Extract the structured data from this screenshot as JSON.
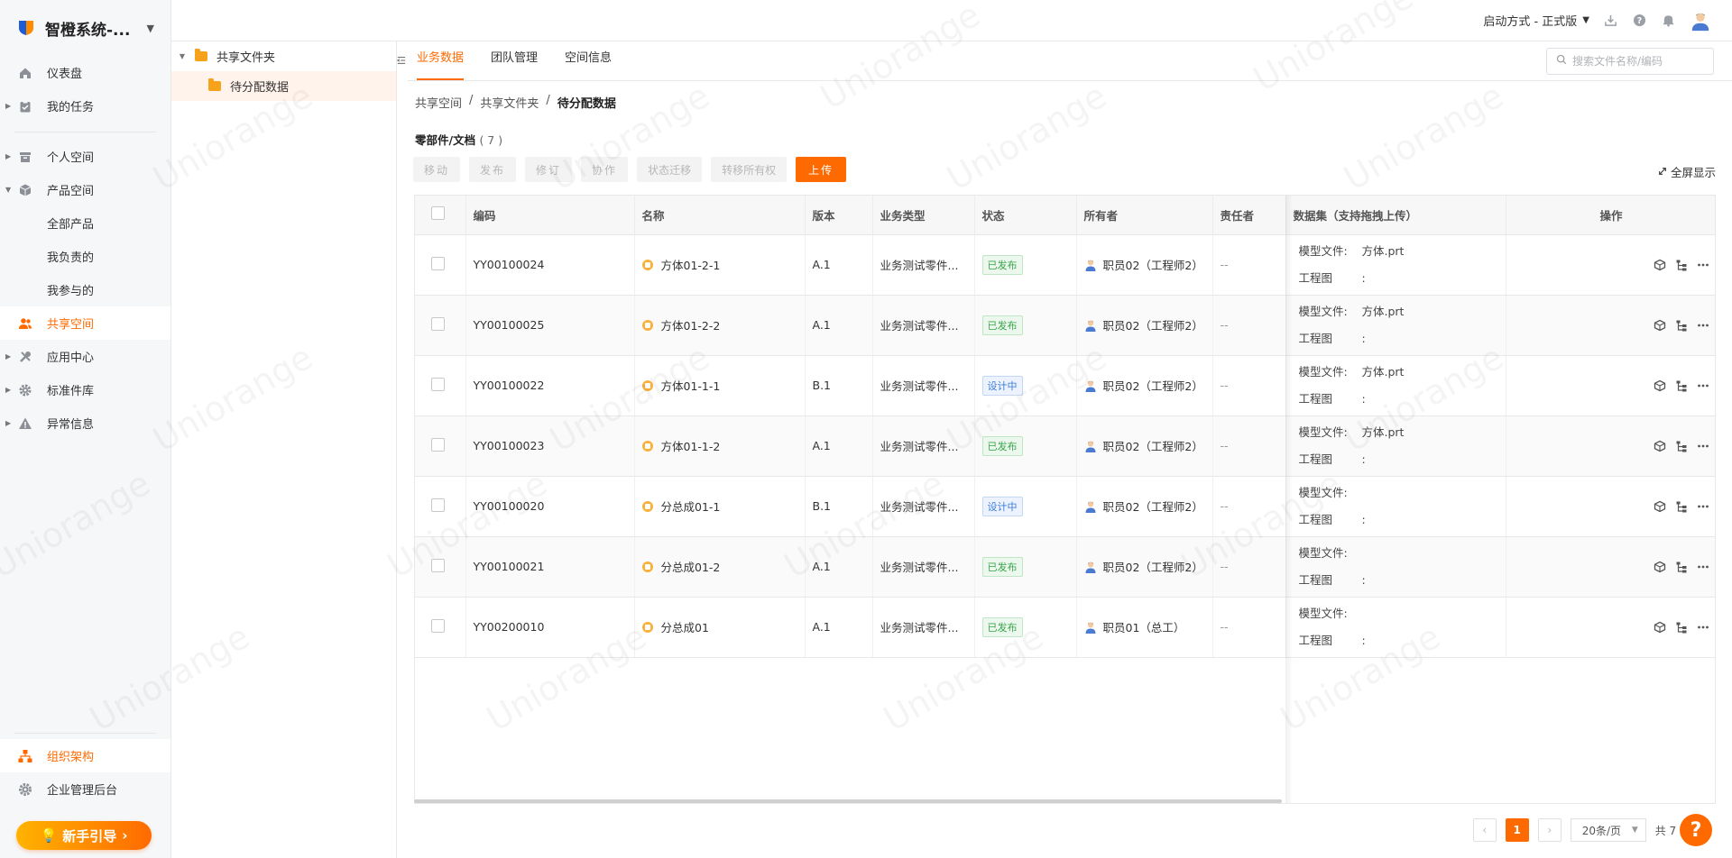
{
  "app": {
    "brand": "智橙系统-...",
    "accent": "#ff6a00"
  },
  "topbar": {
    "launch_mode": "启动方式 - 正式版"
  },
  "sidebar": {
    "items": [
      {
        "label": "仪表盘",
        "icon": "home-icon"
      },
      {
        "label": "我的任务",
        "icon": "task-icon"
      },
      {
        "label": "个人空间",
        "icon": "box-icon"
      },
      {
        "label": "产品空间",
        "icon": "cube-icon"
      },
      {
        "label": "全部产品"
      },
      {
        "label": "我负责的"
      },
      {
        "label": "我参与的"
      },
      {
        "label": "共享空间",
        "icon": "users-icon"
      },
      {
        "label": "应用中心",
        "icon": "tools-icon"
      },
      {
        "label": "标准件库",
        "icon": "gear-icon"
      },
      {
        "label": "异常信息",
        "icon": "warning-icon"
      }
    ],
    "bottom": [
      {
        "label": "组织架构",
        "icon": "org-icon"
      },
      {
        "label": "企业管理后台",
        "icon": "settings-icon"
      }
    ],
    "guide": "新手引导"
  },
  "tree": {
    "root": "共享文件夹",
    "child": "待分配数据"
  },
  "tabs": [
    "业务数据",
    "团队管理",
    "空间信息"
  ],
  "search": {
    "placeholder": "搜索文件名称/编码"
  },
  "breadcrumb": [
    "共享空间",
    "共享文件夹",
    "待分配数据"
  ],
  "section": {
    "title": "零部件/文档",
    "count": "( 7 )"
  },
  "toolbar": {
    "move": "移动",
    "publish": "发布",
    "revise": "修订",
    "collab": "协作",
    "state": "状态迁移",
    "transfer": "转移所有权",
    "upload": "上传",
    "fullscreen": "全屏显示"
  },
  "table": {
    "headers": {
      "code": "编码",
      "name": "名称",
      "version": "版本",
      "type": "业务类型",
      "status": "状态",
      "owner": "所有者",
      "assignee": "责任者",
      "dataset": "数据集（支持拖拽上传）",
      "ops": "操作"
    },
    "model_label": "模型文件:",
    "drawing_label": "工程图",
    "rows": [
      {
        "code": "YY00100024",
        "name": "方体01-2-1",
        "version": "A.1",
        "type": "业务测试零件...",
        "status": "已发布",
        "owner": "职员02（工程师2）",
        "assignee": "--",
        "model": "方体.prt",
        "drawing": ":"
      },
      {
        "code": "YY00100025",
        "name": "方体01-2-2",
        "version": "A.1",
        "type": "业务测试零件...",
        "status": "已发布",
        "owner": "职员02（工程师2）",
        "assignee": "--",
        "model": "方体.prt",
        "drawing": ":"
      },
      {
        "code": "YY00100022",
        "name": "方体01-1-1",
        "version": "B.1",
        "type": "业务测试零件...",
        "status": "设计中",
        "owner": "职员02（工程师2）",
        "assignee": "--",
        "model": "方体.prt",
        "drawing": ":"
      },
      {
        "code": "YY00100023",
        "name": "方体01-1-2",
        "version": "A.1",
        "type": "业务测试零件...",
        "status": "已发布",
        "owner": "职员02（工程师2）",
        "assignee": "--",
        "model": "方体.prt",
        "drawing": ":"
      },
      {
        "code": "YY00100020",
        "name": "分总成01-1",
        "version": "B.1",
        "type": "业务测试零件...",
        "status": "设计中",
        "owner": "职员02（工程师2）",
        "assignee": "--",
        "model": "",
        "drawing": ":"
      },
      {
        "code": "YY00100021",
        "name": "分总成01-2",
        "version": "A.1",
        "type": "业务测试零件...",
        "status": "已发布",
        "owner": "职员02（工程师2）",
        "assignee": "--",
        "model": "",
        "drawing": ":"
      },
      {
        "code": "YY00200010",
        "name": "分总成01",
        "version": "A.1",
        "type": "业务测试零件...",
        "status": "已发布",
        "owner": "职员01（总工）",
        "assignee": "--",
        "model": "",
        "drawing": ":"
      }
    ]
  },
  "pagination": {
    "current": "1",
    "page_size": "20条/页",
    "total": "共 7 条记录"
  },
  "watermark": "Uniorange"
}
